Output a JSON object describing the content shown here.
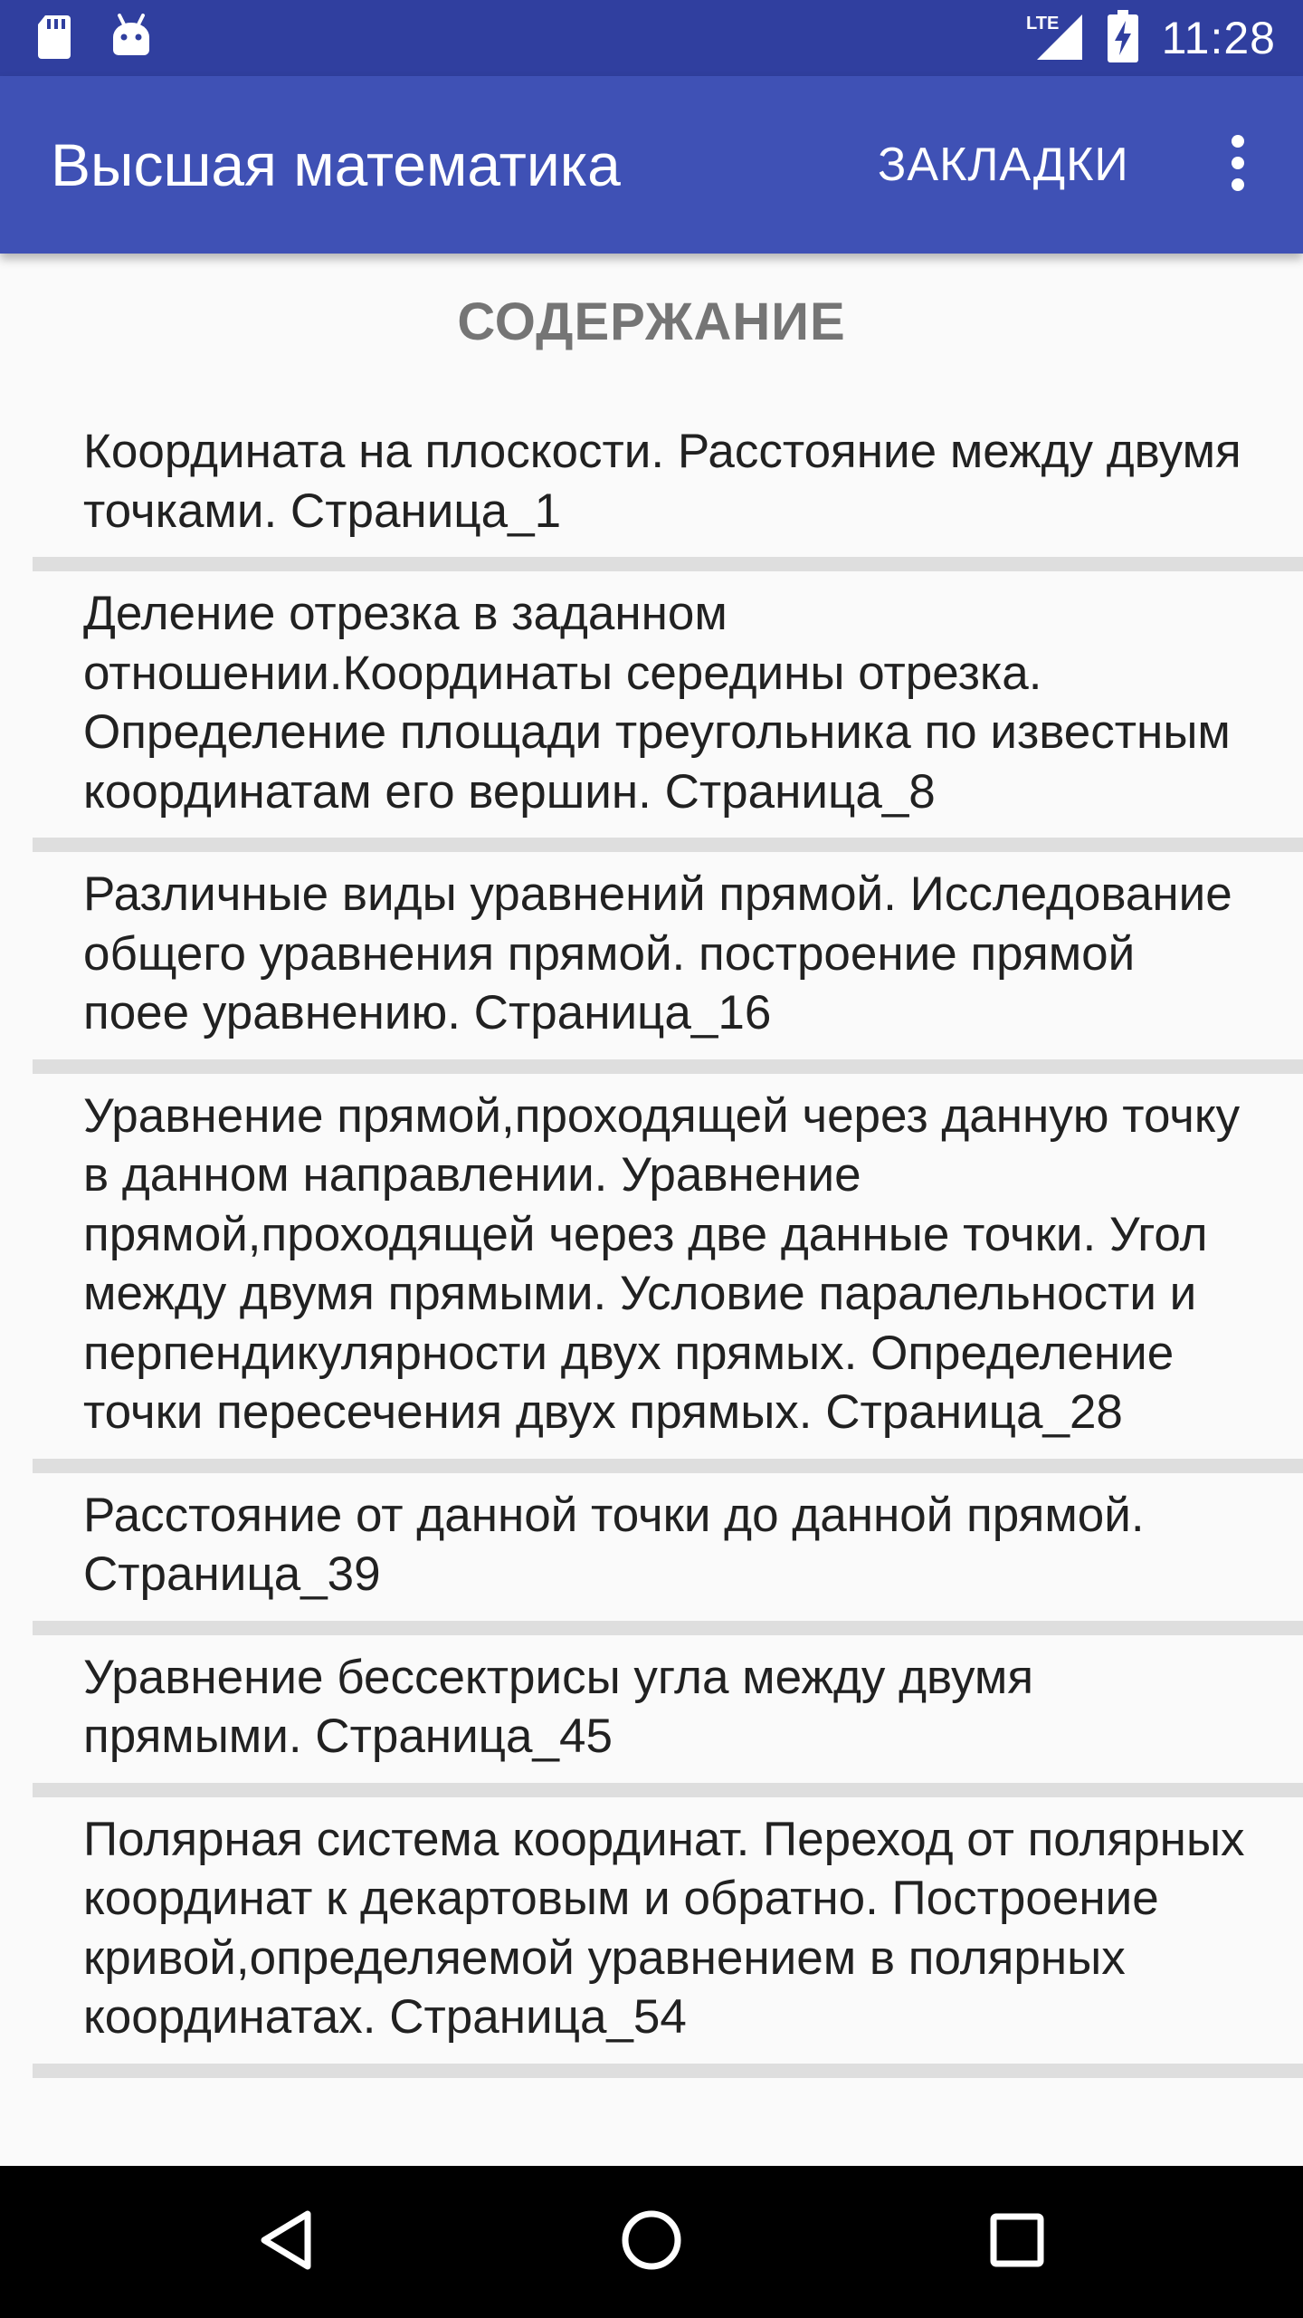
{
  "status_bar": {
    "time": "11:28",
    "network_label": "LTE",
    "icons": [
      "sd-card-icon",
      "android-icon",
      "lte-signal-icon",
      "battery-charging-icon"
    ]
  },
  "app_bar": {
    "title": "Высшая математика",
    "bookmarks_label": "ЗАКЛАДКИ",
    "overflow_icon": "more-vert-icon",
    "colors": {
      "status_bar": "#303f9f",
      "app_bar": "#3f51b5"
    }
  },
  "content": {
    "heading": "СОДЕРЖАНИЕ",
    "items": [
      {
        "text": "Координата на плоскости. Расстояние между двумя точками. Страница_1"
      },
      {
        "text": "Деление отрезка в заданном отношении.Координаты середины отрезка. Определение площади треугольника по известным координатам его вершин. Страница_8"
      },
      {
        "text": "Различные виды уравнений прямой. Исследование общего уравнения прямой. построение прямой поее уравнению. Страница_16"
      },
      {
        "text": "Уравнение прямой,проходящей через данную точку в данном направлении. Уравнение прямой,проходящей через две данные точки. Угол между двумя прямыми. Условие паралельности и перпендикулярности двух прямых. Определение точки пересечения двух прямых. Страница_28"
      },
      {
        "text": "Расстояние от данной точки до данной прямой. Страница_39"
      },
      {
        "text": "Уравнение бессектрисы угла между двумя прямыми. Страница_45"
      },
      {
        "text": "Полярная система координат. Переход от полярных координат к декартовым и обратно. Построение кривой,определяемой уравнением в полярных координатах. Страница_54"
      }
    ]
  },
  "nav_bar": {
    "buttons": [
      "back-icon",
      "home-icon",
      "recents-icon"
    ]
  }
}
